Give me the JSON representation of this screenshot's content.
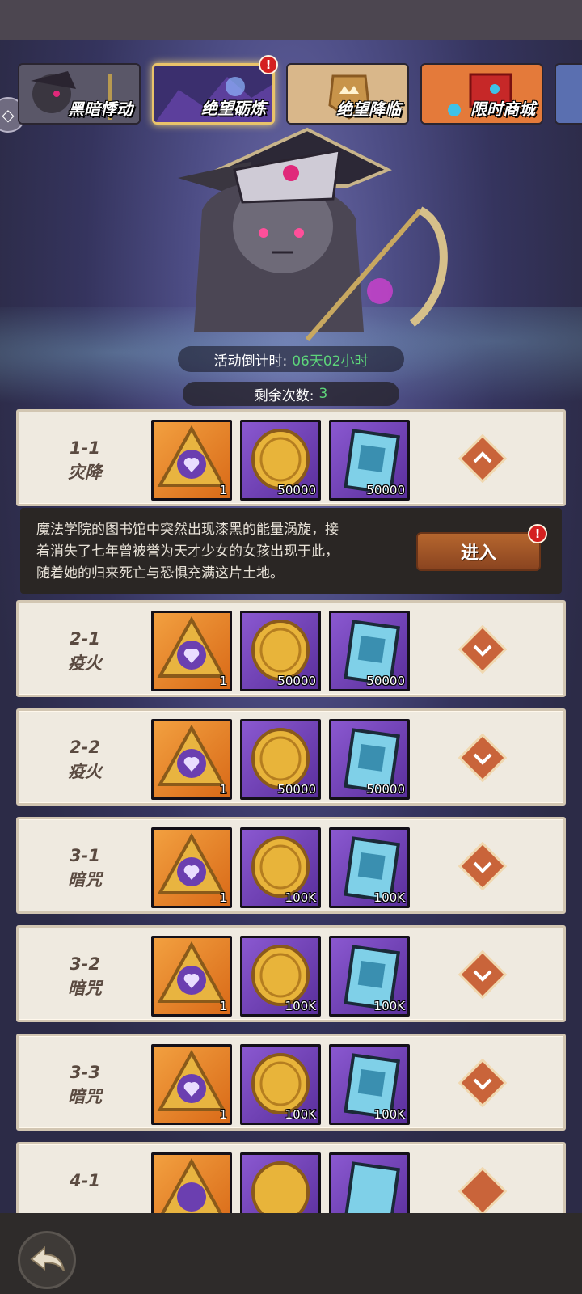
{
  "tabs": [
    {
      "label": "黑暗悸动",
      "icon": "dark-heroine-icon",
      "active": false,
      "badge": ""
    },
    {
      "label": "绝望砺炼",
      "icon": "dragon-crystal-icon",
      "active": true,
      "badge": "!"
    },
    {
      "label": "绝望降临",
      "icon": "crown-crest-icon",
      "active": false,
      "badge": ""
    },
    {
      "label": "限时商城",
      "icon": "treasure-chest-icon",
      "active": false,
      "badge": ""
    }
  ],
  "event": {
    "countdown_label": "活动倒计时:",
    "countdown_value": "06天02小时",
    "remaining_label": "剩余次数:",
    "remaining_value": "3"
  },
  "stages": [
    {
      "id": "1-1",
      "name": "灾降",
      "expanded": true,
      "rewards": [
        "1",
        "50000",
        "50000"
      ]
    },
    {
      "id": "2-1",
      "name": "疫火",
      "expanded": false,
      "rewards": [
        "1",
        "50000",
        "50000"
      ]
    },
    {
      "id": "2-2",
      "name": "疫火",
      "expanded": false,
      "rewards": [
        "1",
        "50000",
        "50000"
      ]
    },
    {
      "id": "3-1",
      "name": "暗咒",
      "expanded": false,
      "rewards": [
        "1",
        "100K",
        "100K"
      ]
    },
    {
      "id": "3-2",
      "name": "暗咒",
      "expanded": false,
      "rewards": [
        "1",
        "100K",
        "100K"
      ]
    },
    {
      "id": "3-3",
      "name": "暗咒",
      "expanded": false,
      "rewards": [
        "1",
        "100K",
        "100K"
      ]
    },
    {
      "id": "4-1",
      "name": "",
      "expanded": false,
      "rewards": [
        "",
        "",
        ""
      ]
    }
  ],
  "reward_icons": [
    "heart-rune-icon",
    "gold-coin-icon",
    "skill-book-icon"
  ],
  "detail": {
    "description_lines": [
      "魔法学院的图书馆中突然出现漆黑的能量涡旋，接",
      "着消失了七年曾被誉为天才少女的女孩出现于此，",
      "随着她的归来死亡与恐惧充满这片土地。"
    ],
    "enter_label": "进入",
    "enter_badge": "!"
  },
  "colors": {
    "accent_green": "#5dd47a",
    "badge_red": "#d42020",
    "panel_beige": "#efeae0",
    "expand_orange": "#c9643a"
  }
}
